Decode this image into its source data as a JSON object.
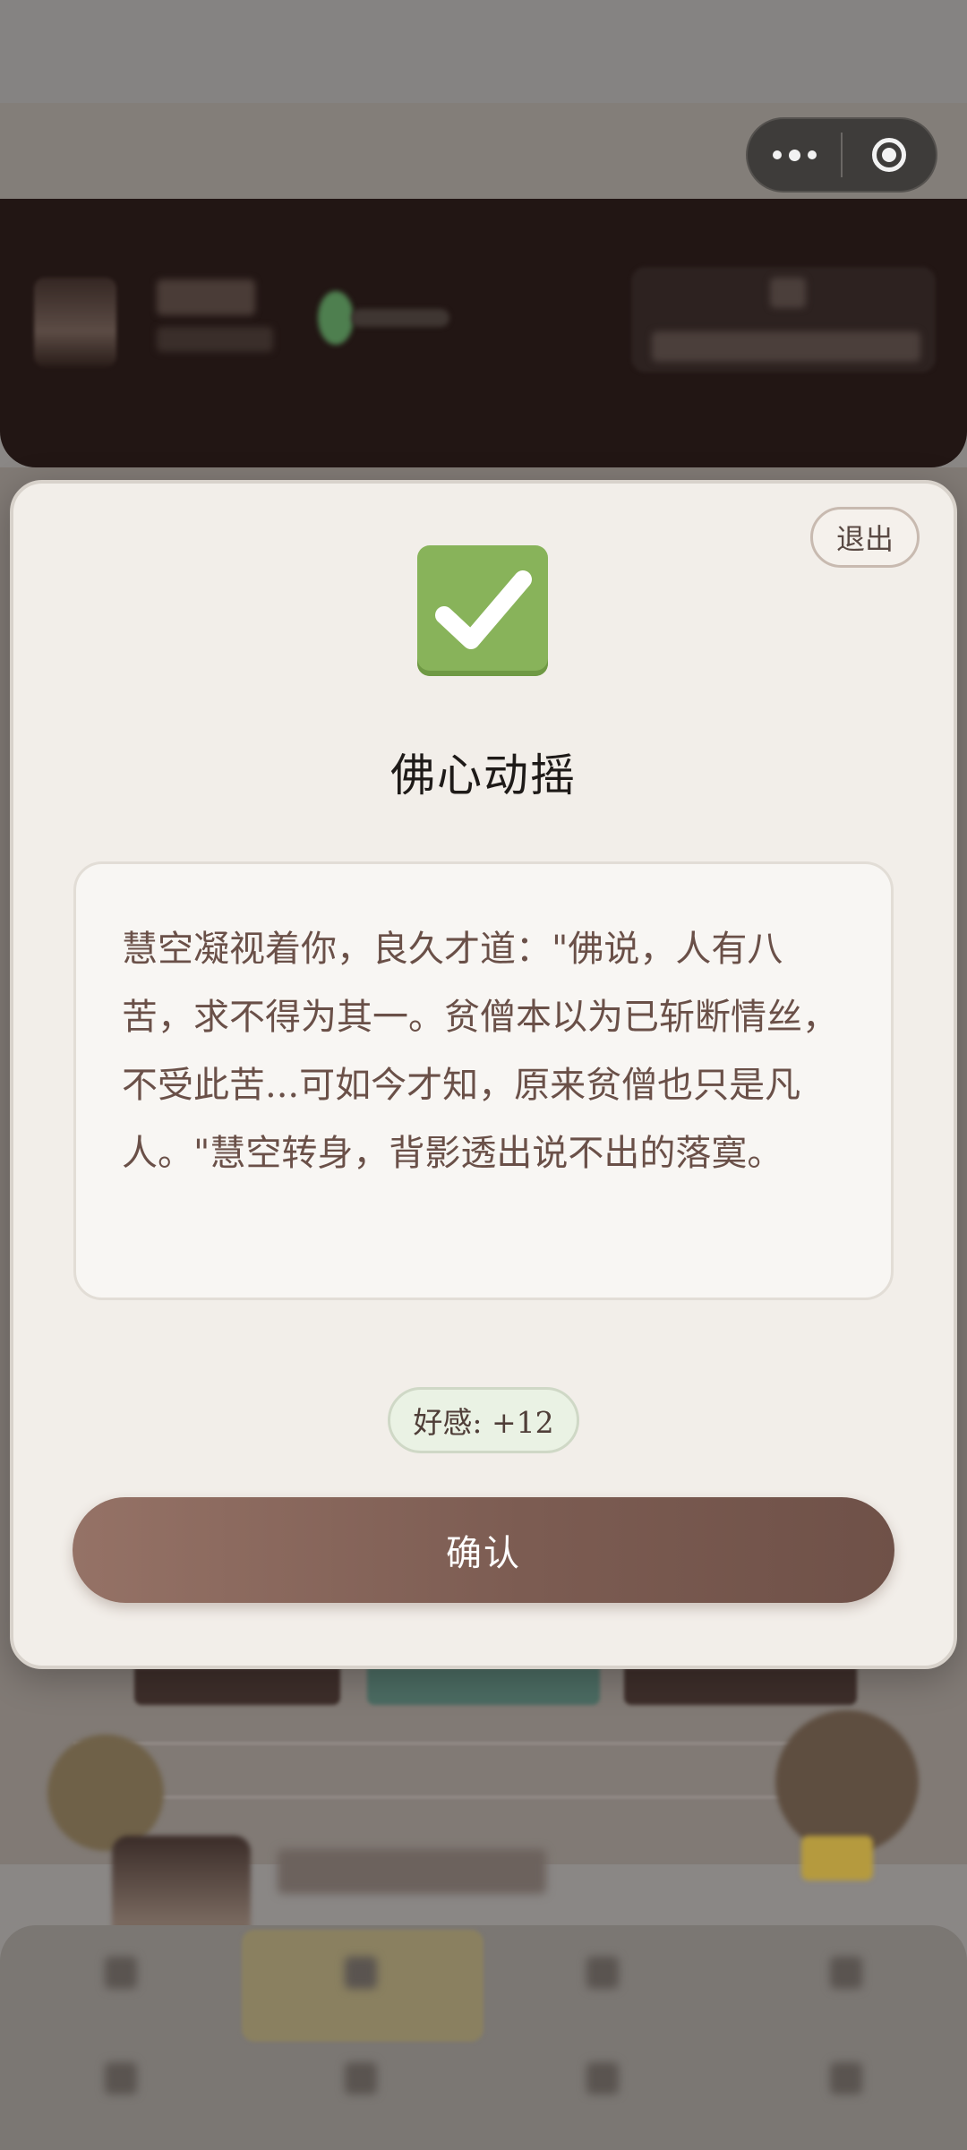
{
  "modal": {
    "exit_label": "退出",
    "status_icon": "check-mark-button",
    "title": "佛心动摇",
    "story": "慧空凝视着你，良久才道：\"佛说，人有八苦，求不得为其一。贫僧本以为已斩断情丝，不受此苦...可如今才知，原来贫僧也只是凡人。\"慧空转身，背影透出说不出的落寞。",
    "affinity_label": "好感: +12",
    "confirm_label": "确认"
  },
  "capsule": {
    "more_icon": "more-dots-icon",
    "close_icon": "close-target-icon"
  },
  "colors": {
    "modal_bg": "#f2eee9",
    "confirm_button": "#7c5c52",
    "affinity_badge_bg": "#eaf2e4",
    "check_green": "#88b35a",
    "story_text": "#6a5048"
  }
}
